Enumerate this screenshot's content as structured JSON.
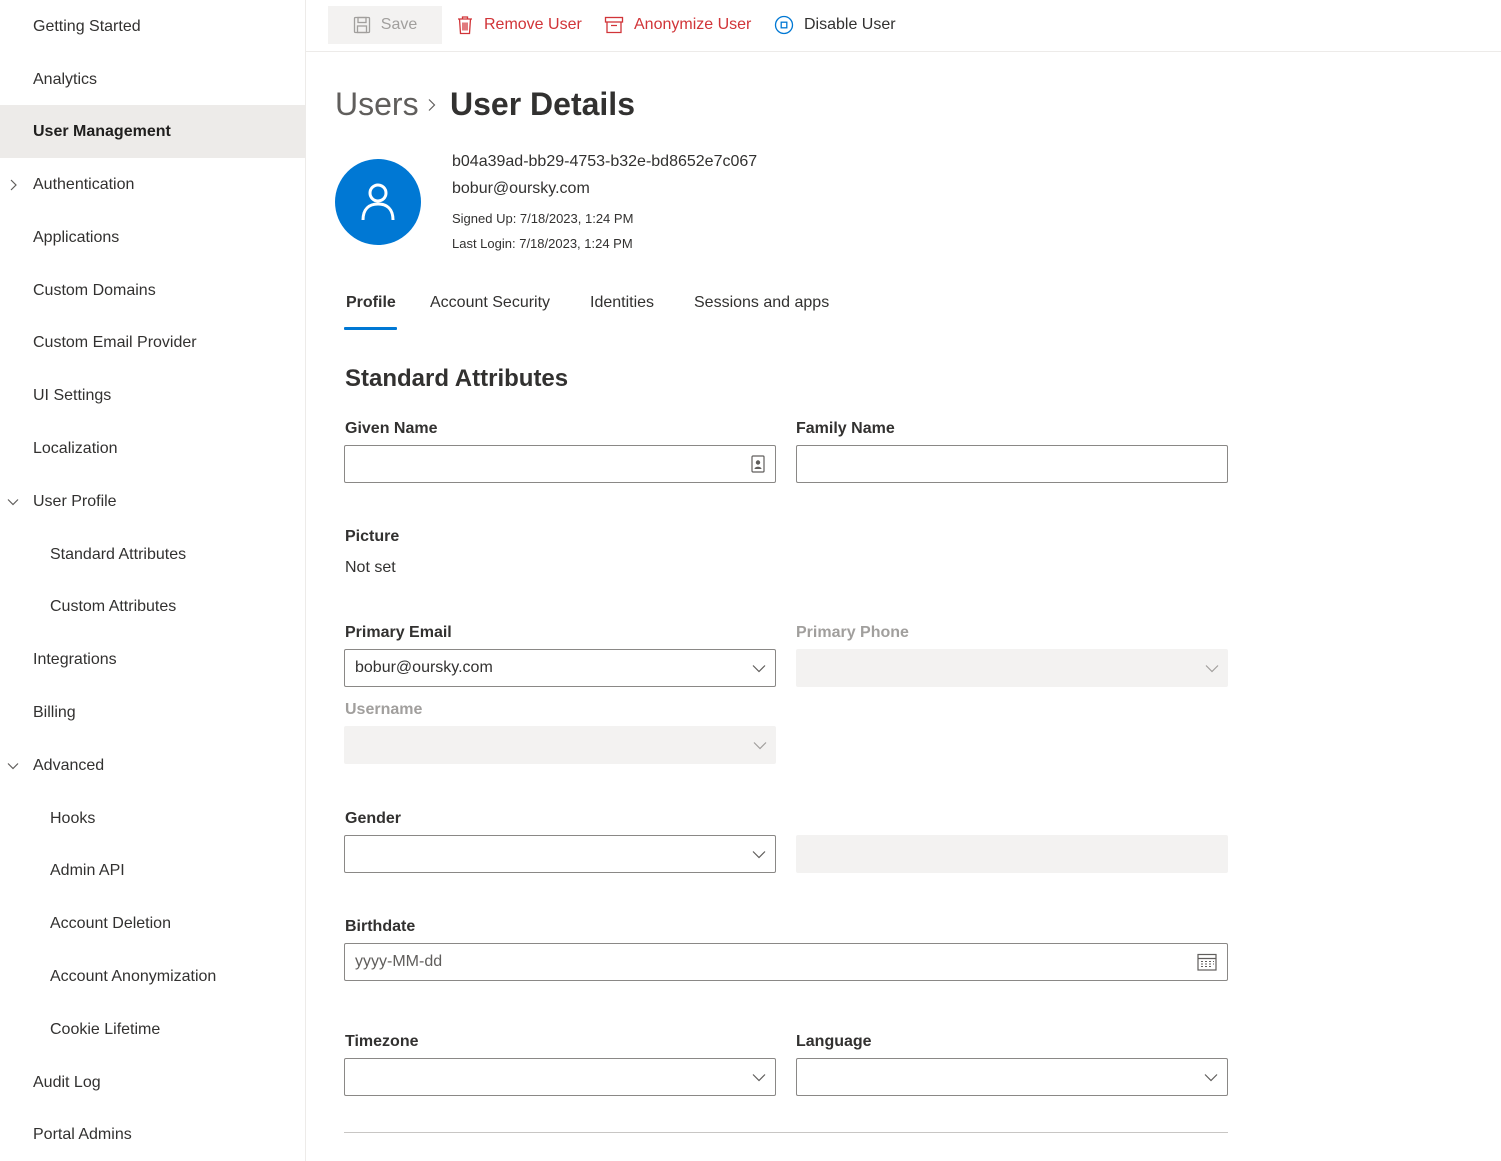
{
  "sidebar": {
    "items": [
      {
        "label": "Getting Started"
      },
      {
        "label": "Analytics"
      },
      {
        "label": "User Management"
      },
      {
        "label": "Authentication"
      },
      {
        "label": "Applications"
      },
      {
        "label": "Custom Domains"
      },
      {
        "label": "Custom Email Provider"
      },
      {
        "label": "UI Settings"
      },
      {
        "label": "Localization"
      },
      {
        "label": "User Profile"
      },
      {
        "label": "Standard Attributes"
      },
      {
        "label": "Custom Attributes"
      },
      {
        "label": "Integrations"
      },
      {
        "label": "Billing"
      },
      {
        "label": "Advanced"
      },
      {
        "label": "Hooks"
      },
      {
        "label": "Admin API"
      },
      {
        "label": "Account Deletion"
      },
      {
        "label": "Account Anonymization"
      },
      {
        "label": "Cookie Lifetime"
      },
      {
        "label": "Audit Log"
      },
      {
        "label": "Portal Admins"
      }
    ]
  },
  "toolbar": {
    "save_label": "Save",
    "remove_label": "Remove User",
    "anonymize_label": "Anonymize User",
    "disable_label": "Disable User"
  },
  "breadcrumb": {
    "parent": "Users",
    "current": "User Details"
  },
  "user": {
    "id": "b04a39ad-bb29-4753-b32e-bd8652e7c067",
    "email": "bobur@oursky.com",
    "signed_up": "Signed Up: 7/18/2023, 1:24 PM",
    "last_login": "Last Login: 7/18/2023, 1:24 PM"
  },
  "tabs": [
    {
      "label": "Profile"
    },
    {
      "label": "Account Security"
    },
    {
      "label": "Identities"
    },
    {
      "label": "Sessions and apps"
    }
  ],
  "form": {
    "section_title": "Standard Attributes",
    "given_name_label": "Given Name",
    "given_name_value": "",
    "family_name_label": "Family Name",
    "family_name_value": "",
    "picture_label": "Picture",
    "picture_value": "Not set",
    "primary_email_label": "Primary Email",
    "primary_email_value": "bobur@oursky.com",
    "primary_phone_label": "Primary Phone",
    "primary_phone_value": "",
    "username_label": "Username",
    "username_value": "",
    "gender_label": "Gender",
    "gender_value": "",
    "gender_other_value": "",
    "birthdate_label": "Birthdate",
    "birthdate_placeholder": "yyyy-MM-dd",
    "timezone_label": "Timezone",
    "timezone_value": "",
    "language_label": "Language",
    "language_value": ""
  },
  "colors": {
    "accent": "#0078d4",
    "danger": "#d13438",
    "active_nav_bg": "#edebe9",
    "disabled_bg": "#f3f2f1"
  },
  "icons": {
    "save": "save-icon",
    "remove": "trash-icon",
    "anonymize": "archive-icon",
    "disable": "stop-circle-icon",
    "avatar": "user-icon",
    "calendar": "calendar-icon",
    "contact": "contact-card-icon"
  }
}
